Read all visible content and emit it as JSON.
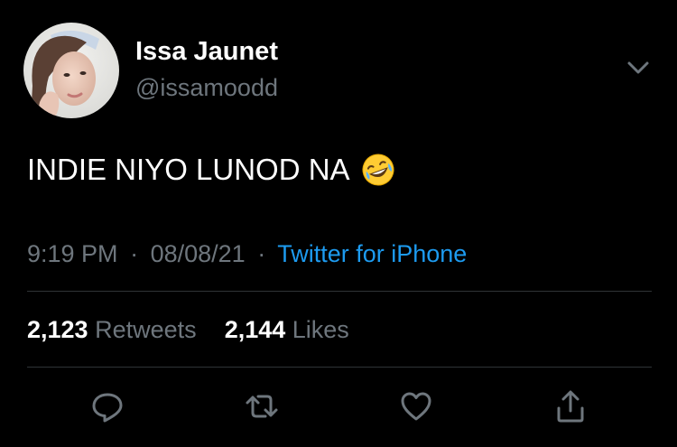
{
  "author": {
    "name": "Issa Jaunet",
    "handle": "@issamoodd"
  },
  "tweet": {
    "text": "INDIE NIYO LUNOD NA",
    "emoji": "rolling-on-the-floor-laughing"
  },
  "meta": {
    "time": "9:19 PM",
    "date": "08/08/21",
    "separator": "·",
    "source": "Twitter for iPhone"
  },
  "stats": {
    "retweets_count": "2,123",
    "retweets_label": "Retweets",
    "likes_count": "2,144",
    "likes_label": "Likes"
  },
  "icons": {
    "more": "chevron-down-icon",
    "reply": "reply-icon",
    "retweet": "retweet-icon",
    "like": "heart-icon",
    "share": "share-icon"
  },
  "colors": {
    "background": "#000000",
    "primary_text": "#ffffff",
    "secondary_text": "#6e767d",
    "link": "#1d9bf0",
    "divider": "#2f3336"
  }
}
